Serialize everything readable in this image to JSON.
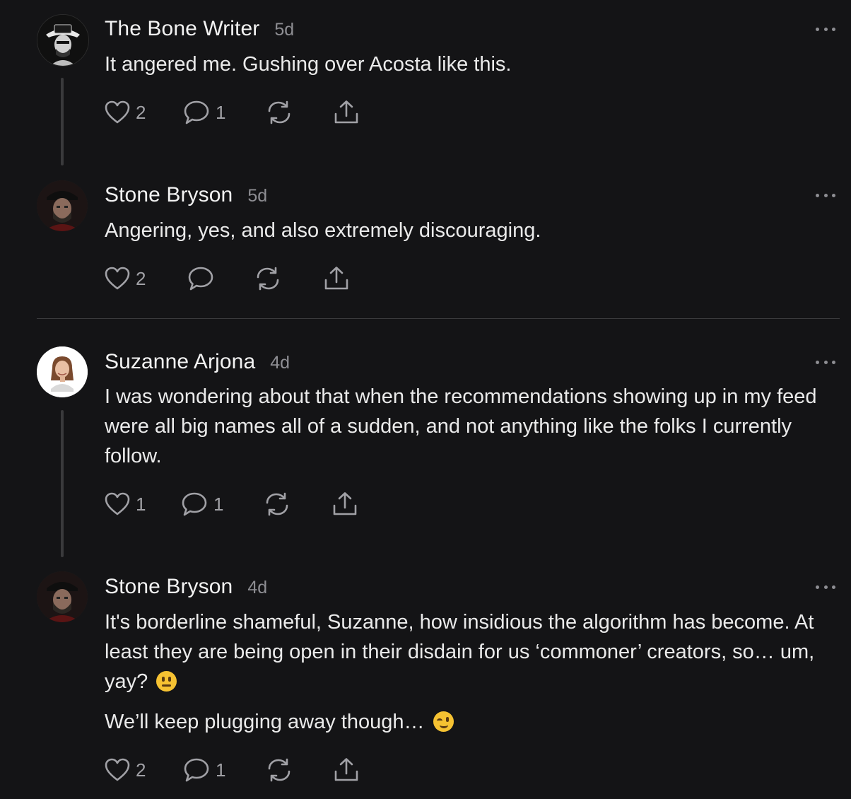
{
  "comments": [
    {
      "author": "The Bone Writer",
      "time": "5d",
      "paragraphs": [
        "It angered me. Gushing over Acosta like this."
      ],
      "likes": "2",
      "replies": "1",
      "avatar_icon": "bone-writer-avatar"
    },
    {
      "author": "Stone Bryson",
      "time": "5d",
      "paragraphs": [
        "Angering, yes, and also extremely discouraging."
      ],
      "likes": "2",
      "replies": "",
      "avatar_icon": "stone-bryson-avatar"
    },
    {
      "author": "Suzanne Arjona",
      "time": "4d",
      "paragraphs": [
        "I was wondering about that when the recommendations showing up in my feed were all big names all of a sudden, and not anything like the folks I currently follow."
      ],
      "likes": "1",
      "replies": "1",
      "avatar_icon": "suzanne-arjona-avatar"
    },
    {
      "author": "Stone Bryson",
      "time": "4d",
      "paragraphs": [
        "It's borderline shameful, Suzanne, how insidious the algorithm has become. At least they are being open in their disdain for us ‘commoner’ creators, so… um, yay?",
        "We’ll keep plugging away though…"
      ],
      "emojis": [
        "neutral-face-emoji",
        "winking-face-emoji"
      ],
      "likes": "2",
      "replies": "1",
      "avatar_icon": "stone-bryson-avatar"
    }
  ],
  "colors": {
    "background": "#141416",
    "text": "#eaeaea",
    "muted": "#8e8e93",
    "thread_line": "#3a3a3c",
    "emoji": "#f6c232"
  }
}
